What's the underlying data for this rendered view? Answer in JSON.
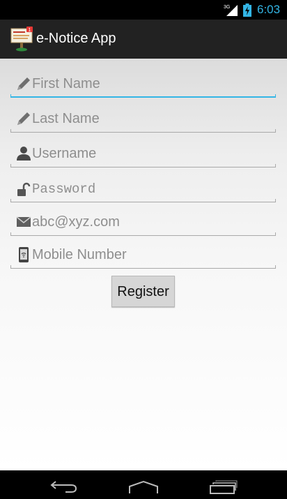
{
  "status_bar": {
    "network_label": "3G",
    "time": "6:03",
    "accent_color": "#33b5e5"
  },
  "action_bar": {
    "title": "e-Notice App",
    "icon": "notice-board-icon"
  },
  "form": {
    "fields": [
      {
        "id": "first-name",
        "placeholder": "First Name",
        "icon": "pencil-icon",
        "focused": true
      },
      {
        "id": "last-name",
        "placeholder": "Last Name",
        "icon": "pencil-icon",
        "focused": false
      },
      {
        "id": "username",
        "placeholder": "Username",
        "icon": "person-icon",
        "focused": false
      },
      {
        "id": "password",
        "placeholder": "Password",
        "icon": "unlocked-padlock-icon",
        "focused": false
      },
      {
        "id": "email",
        "placeholder": "abc@xyz.com",
        "icon": "envelope-icon",
        "focused": false
      },
      {
        "id": "mobile",
        "placeholder": "Mobile Number",
        "icon": "mobile-phone-icon",
        "focused": false
      }
    ],
    "register_label": "Register"
  },
  "nav_bar": {
    "buttons": [
      "back-icon",
      "home-icon",
      "recent-apps-icon"
    ]
  }
}
